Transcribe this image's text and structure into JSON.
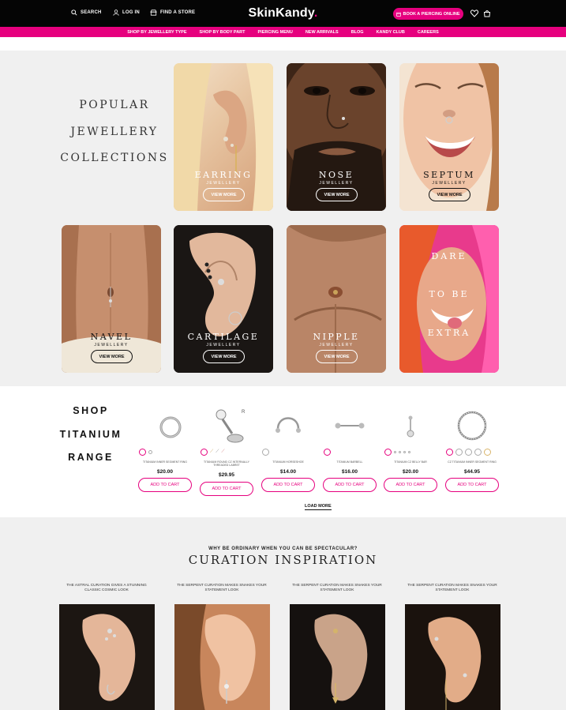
{
  "header": {
    "search_label": "SEARCH",
    "login_label": "LOG IN",
    "store_label": "FIND A STORE",
    "logo_text": "SkinKandy",
    "logo_dot": ".",
    "book_label": "BOOK A PIERCING ONLINE",
    "nav": [
      "SHOP BY JEWELLERY TYPE",
      "SHOP BY BODY PART",
      "PIERCING MENU",
      "NEW ARRIVALS",
      "BLOG",
      "KANDY CLUB",
      "CAREERS"
    ]
  },
  "collections": {
    "title_lines": [
      "POPULAR",
      "JEWELLERY",
      "COLLECTIONS"
    ],
    "tiles": [
      {
        "name": "EARRING",
        "sub": "JEWELLERY",
        "cta": "VIEW MORE"
      },
      {
        "name": "NOSE",
        "sub": "JEWELLERY",
        "cta": "VIEW MORE"
      },
      {
        "name": "SEPTUM",
        "sub": "JEWELLERY",
        "cta": "VIEW MORE"
      },
      {
        "name": "NAVEL",
        "sub": "JEWELLERY",
        "cta": "VIEW MORE"
      },
      {
        "name": "CARTILAGE",
        "sub": "JEWELLERY",
        "cta": "VIEW MORE"
      },
      {
        "name": "NIPPLE",
        "sub": "JEWELLERY",
        "cta": "VIEW MORE"
      }
    ],
    "promo_lines": [
      "DARE",
      "TO BE",
      "EXTRA"
    ]
  },
  "titanium": {
    "title_lines": [
      "SHOP",
      "TITANIUM",
      "RANGE"
    ],
    "products": [
      {
        "name": "TITANIUM INNER SEGMENT RING",
        "price": "$20.00",
        "cta": "ADD TO CART"
      },
      {
        "name": "TITANIUM ROUND CZ INTERNALLY THREADED LABRET",
        "price": "$29.95",
        "cta": "ADD TO CART"
      },
      {
        "name": "TITANIUM HORSESHOE",
        "price": "$14.00",
        "cta": "ADD TO CART"
      },
      {
        "name": "TITANIUM BARBELL",
        "price": "$16.00",
        "cta": "ADD TO CART"
      },
      {
        "name": "TITANIUM CZ BELLY BAR",
        "price": "$20.00",
        "cta": "ADD TO CART"
      },
      {
        "name": "CZ TITANIUM INNER SEGMENT RING",
        "price": "$44.95",
        "cta": "ADD TO CART"
      }
    ],
    "load_more": "LOAD MORE"
  },
  "curation": {
    "eyebrow": "WHY BE ORDINARY WHEN YOU CAN BE SPECTACULAR?",
    "title": "CURATION INSPIRATION",
    "captions": [
      "THE ASTRAL CURATION GIVES A STUNNING CLASSIC COSMIC LOOK",
      "THE SERPENT CURATION MAKES SNAKES YOUR STATEMENT LOOK",
      "THE SERPENT CURATION MAKES SNAKES YOUR STATEMENT LOOK",
      "THE SERPENT CURATION MAKES SNAKES YOUR STATEMENT LOOK"
    ]
  },
  "colors": {
    "brand_pink": "#e6007e",
    "header_black": "#050505",
    "page_bg": "#f0f0f0"
  }
}
